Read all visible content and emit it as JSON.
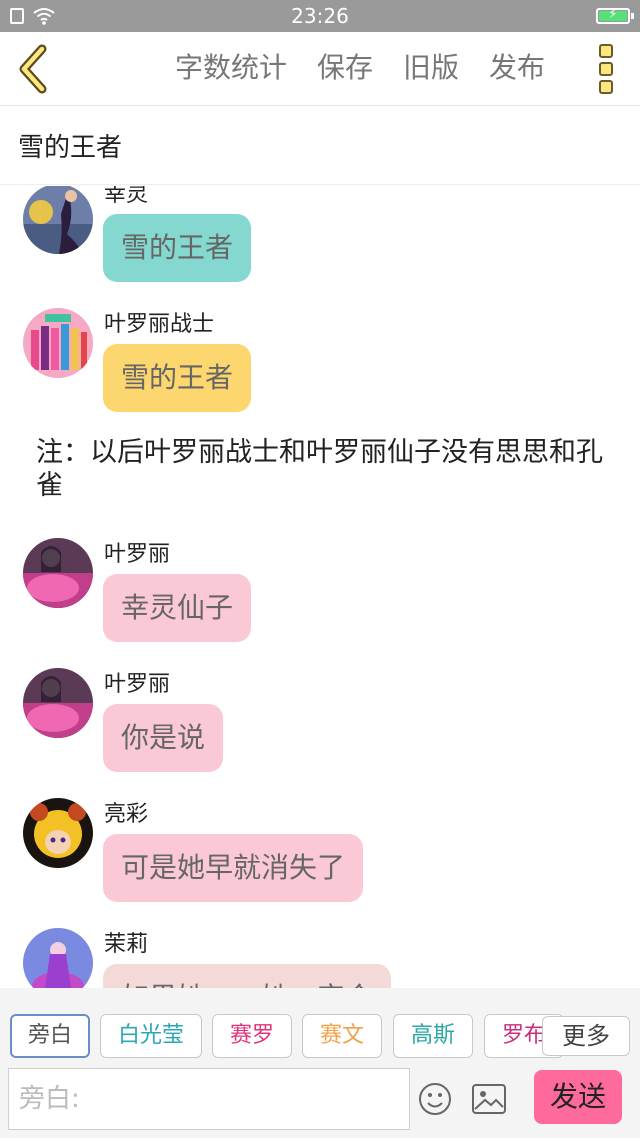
{
  "status_bar": {
    "time": "23:26",
    "icons": [
      "sim-icon",
      "wifi-icon",
      "battery-charging-icon"
    ],
    "battery_color": "#55e07a"
  },
  "top_bar": {
    "back_icon": "chevron-left-icon",
    "actions": [
      "字数统计",
      "保存",
      "旧版",
      "发布"
    ],
    "menu_icon": "three-dot-menu-icon",
    "accent": "#fde77f"
  },
  "story_title": "雪的王者",
  "messages": [
    {
      "type": "msg",
      "name": "幸灵",
      "text": "雪的王者",
      "bubble_color": "#85d8cf",
      "avatar": "xingling-avatar"
    },
    {
      "type": "msg",
      "name": "叶罗丽战士",
      "text": "雪的王者",
      "bubble_color": "#fcd66e",
      "avatar": "yeluoli-warriors-avatar"
    },
    {
      "type": "note",
      "text": "注：以后叶罗丽战士和叶罗丽仙子没有思思和孔雀"
    },
    {
      "type": "msg",
      "name": "叶罗丽",
      "text": "幸灵仙子",
      "bubble_color": "#fbc9d6",
      "avatar": "yeluoli-avatar"
    },
    {
      "type": "msg",
      "name": "叶罗丽",
      "text": "你是说",
      "bubble_color": "#fbc9d6",
      "avatar": "yeluoli-avatar"
    },
    {
      "type": "msg",
      "name": "亮彩",
      "text": "可是她早就消失了",
      "bubble_color": "#fbc9d6",
      "avatar": "liangcai-avatar"
    },
    {
      "type": "msg",
      "name": "茉莉",
      "text": "如果她……她一定会",
      "bubble_color": "#f3d9d7",
      "avatar": "moli-avatar"
    }
  ],
  "characters": [
    {
      "label": "旁白",
      "color": "#555555",
      "active": true
    },
    {
      "label": "白光莹",
      "color": "#29a7b5",
      "active": false
    },
    {
      "label": "赛罗",
      "color": "#e0337a",
      "active": false
    },
    {
      "label": "赛文",
      "color": "#f0a24a",
      "active": false
    },
    {
      "label": "高斯",
      "color": "#2aa7a7",
      "active": false
    },
    {
      "label": "罗布",
      "color": "#c8307d",
      "active": false
    }
  ],
  "more_label": "更多",
  "input": {
    "placeholder": "旁白:"
  },
  "input_icons": [
    "emoji-icon",
    "image-icon"
  ],
  "send_label": "发送",
  "send_color": "#ff6a9d"
}
